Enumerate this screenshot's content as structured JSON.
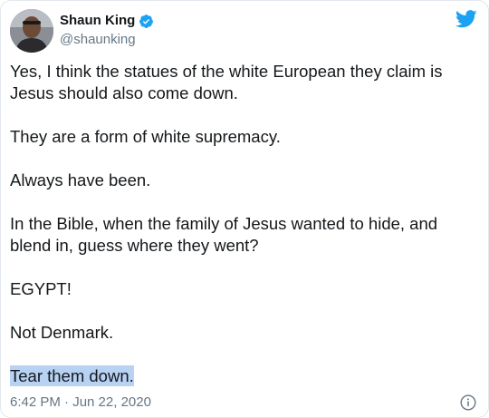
{
  "author": {
    "display_name": "Shaun King",
    "handle": "@shaunking",
    "verified": true,
    "avatar": "avatar-photo"
  },
  "brand_icon": "twitter-bird-icon",
  "colors": {
    "brand": "#1da1f2",
    "text": "#14171a",
    "secondary_text": "#657786",
    "selection_highlight": "#b7d2f3"
  },
  "tweet": {
    "paragraphs": [
      "Yes, I think the statues of the white European they claim is Jesus should also come down.",
      "They are a form of white supremacy.",
      "Always have been.",
      "In the Bible, when the family of Jesus wanted to hide, and blend in, guess where they went?",
      "EGYPT!",
      "Not Denmark."
    ],
    "highlighted_paragraph": "Tear them down.",
    "timestamp": "6:42 PM · Jun 22, 2020"
  },
  "info_icon": "info-icon"
}
